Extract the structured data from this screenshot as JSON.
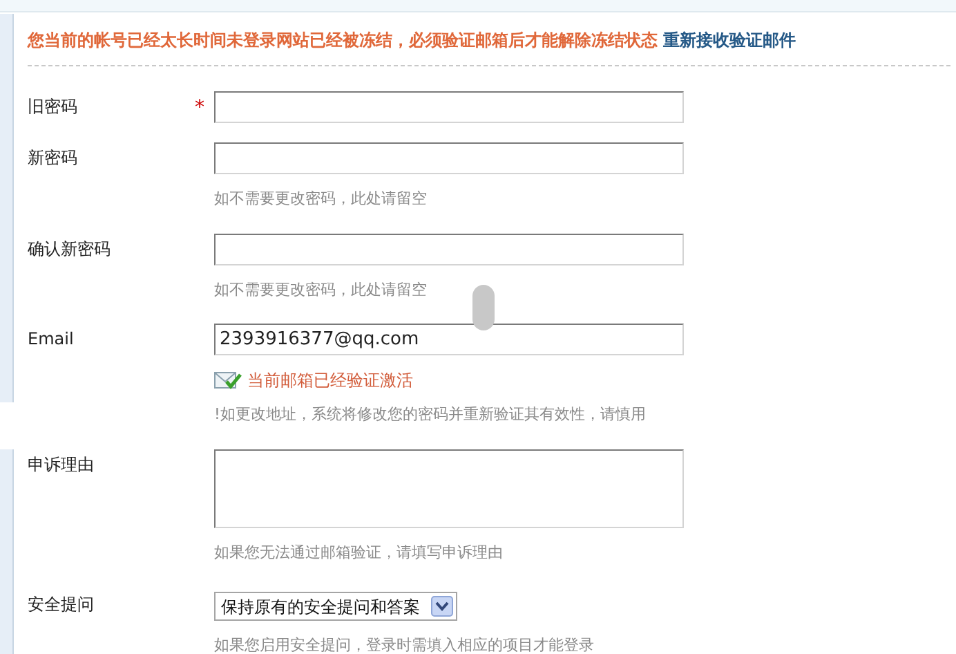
{
  "notice": {
    "message": "您当前的帐号已经太长时间未登录网站已经被冻结，必须验证邮箱后才能解除冻结状态",
    "link": "重新接收验证邮件"
  },
  "fields": [
    {
      "kind": "password",
      "label": "旧密码",
      "required": true
    },
    {
      "kind": "password",
      "label": "新密码",
      "required": false,
      "hint_lines": [
        "如不需要更改密码，此处请留空"
      ]
    },
    {
      "kind": "password",
      "label": "确认新密码",
      "required": false,
      "hint_lines": [
        "如不需要更改密码，此处请留空"
      ]
    },
    {
      "kind": "email",
      "label": "Email",
      "required": false,
      "value": "2393916377@qq.com",
      "status": "当前邮箱已经验证激活",
      "hint_lines": [
        "!如更改地址，系统将修改您的密码并重新验证其有效性，请慎用"
      ]
    },
    {
      "kind": "textarea",
      "label": "申诉理由",
      "required": false,
      "hint_lines": [
        "如果您无法通过邮箱验证，请填写申诉理由"
      ]
    },
    {
      "kind": "select",
      "label": "安全提问",
      "required": false,
      "value": "保持原有的安全提问和答案",
      "hint_lines": [
        "如果您启用安全提问，登录时需填入相应的项目才能登录"
      ]
    }
  ],
  "required_mark": "*"
}
